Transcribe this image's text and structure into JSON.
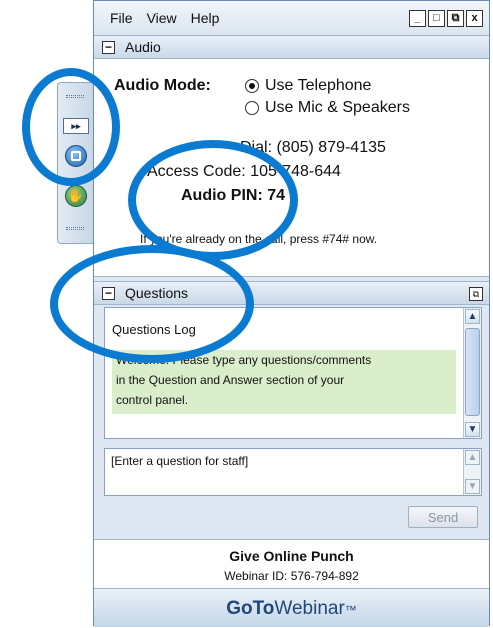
{
  "menu": {
    "items": [
      "File",
      "View",
      "Help"
    ]
  },
  "window_controls": {
    "minimize": "_",
    "maximize": "□",
    "restore": "⧉",
    "close": "x"
  },
  "grabtab": {
    "expand_glyph": "▸▸"
  },
  "audio": {
    "panel_title": "Audio",
    "mode_label": "Audio Mode:",
    "options": [
      "Use Telephone",
      "Use Mic & Speakers"
    ],
    "selected_index": 0,
    "dial_label": "Dial:",
    "dial_value": "(805) 879-4135",
    "access_label": "Access Code:",
    "access_value": "105-748-644",
    "pin_label": "Audio PIN:",
    "pin_value": "74",
    "note": "If you're already on the call, press #74# now."
  },
  "questions": {
    "panel_title": "Questions",
    "log_title": "Questions Log",
    "welcome_lines": [
      "Welcome! Please type any questions/comments",
      "in the Question and Answer section of your",
      "control panel."
    ],
    "input_placeholder": "[Enter a question for staff]",
    "send_label": "Send"
  },
  "webinar": {
    "title": "Give Online Punch",
    "id_line": "Webinar ID: 576-794-892"
  },
  "brand": {
    "goto": "GoTo",
    "webinar": "Webinar",
    "tm": "™"
  },
  "colors": {
    "annotation_circle": "#0b7bd2",
    "welcome_bg": "#dbeecb",
    "brand_text": "#1f4878"
  }
}
